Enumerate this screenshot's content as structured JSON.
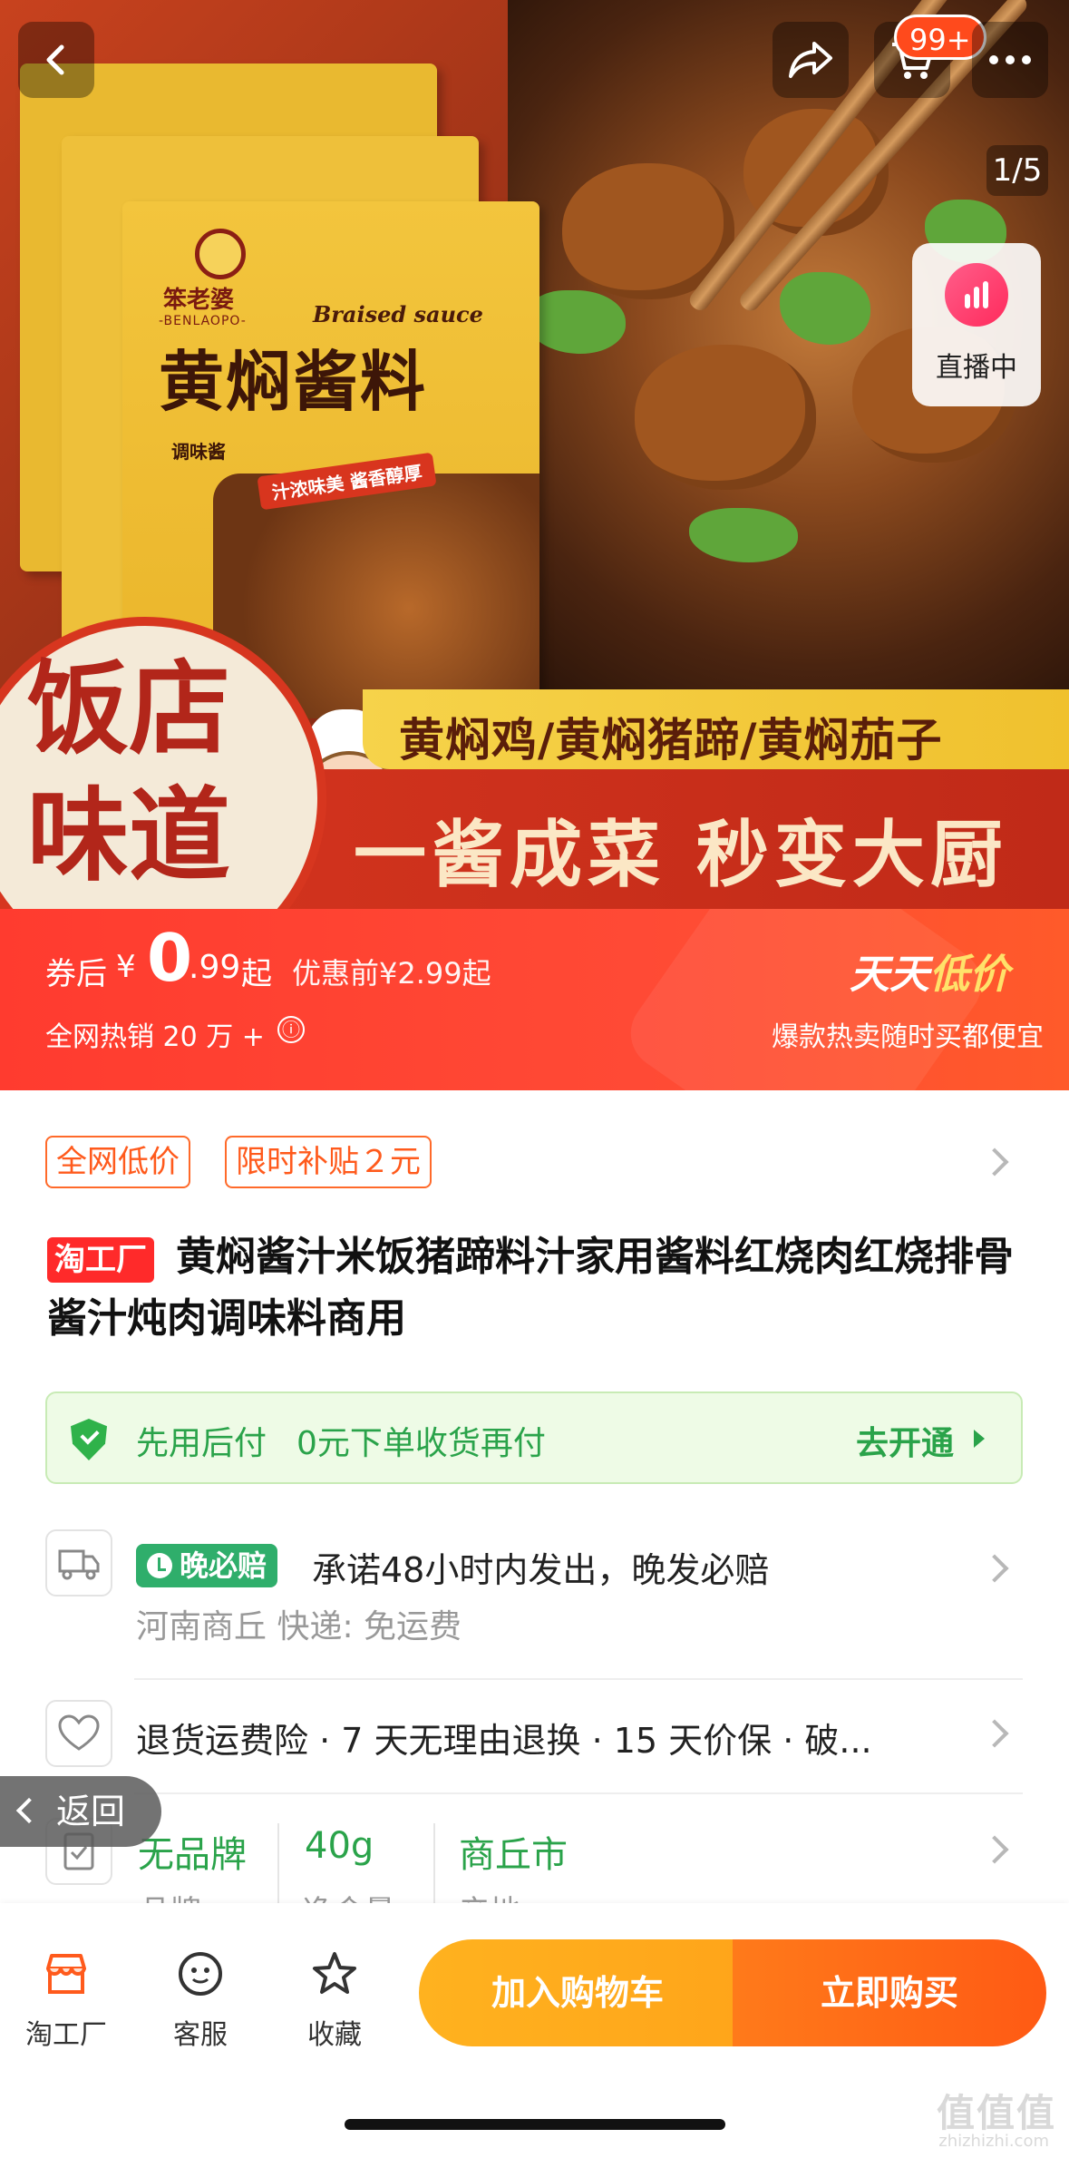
{
  "colors": {
    "accent": "#ff3b2f",
    "green": "#2aa34a",
    "orange": "#ff5a1c",
    "cart_button": "#ffa51a",
    "buy_button": "#ff5a14"
  },
  "hero": {
    "page_counter": "1/5",
    "cart_badge": "99+",
    "live_label": "直播中",
    "package": {
      "brand": "笨老婆",
      "brand_en": "-BENLAOPO-",
      "english": "Braised sauce",
      "title": "黄焖酱料",
      "tag": "调味酱",
      "slogan": "汁浓味美 酱香醇厚"
    },
    "yellow_banner": "黄焖鸡/黄焖猪蹄/黄焖茄子",
    "red_banner": "一酱成菜 秒变大厨",
    "circle_badge": "饭店味道"
  },
  "price": {
    "label": "券后",
    "currency": "¥",
    "integer": "0",
    "decimal": ".99",
    "suffix": "起",
    "before": "优惠前¥2.99起",
    "sales": "全网热销 20 万 +",
    "info_icon": "ⓘ",
    "promo_title_a": "天天",
    "promo_title_b": "低价",
    "promo_sub": "爆款热卖随时买都便宜"
  },
  "tags": [
    "全网低价",
    "限时补贴２元"
  ],
  "title": {
    "badge": "淘工厂",
    "text": "黄焖酱汁米饭猪蹄料汁家用酱料红烧肉红烧排骨酱汁炖肉调味料商用"
  },
  "paylater": {
    "label": "先用后付",
    "sub": "0元下单收货再付",
    "action": "去开通"
  },
  "shipping": {
    "badge": "晚必赔",
    "promise": "承诺48小时内发出，晚发必赔",
    "sub": "河南商丘  快递: 免运费"
  },
  "service": {
    "text": "退货运费险 · 7 天无理由退换 · 15 天价保 · 破..."
  },
  "attributes": [
    {
      "value": "无品牌",
      "label": "品牌"
    },
    {
      "value": "40g",
      "label": "净含量"
    },
    {
      "value": "商丘市",
      "label": "产地"
    }
  ],
  "back_pill": "返回",
  "bottom": {
    "tabs": [
      {
        "label": "淘工厂",
        "icon": "store-icon"
      },
      {
        "label": "客服",
        "icon": "service-icon"
      },
      {
        "label": "收藏",
        "icon": "star-icon"
      }
    ],
    "add_cart": "加入购物车",
    "buy_now": "立即购买"
  },
  "watermark": {
    "main": "值值值",
    "sub": "zhizhizhi.com"
  }
}
